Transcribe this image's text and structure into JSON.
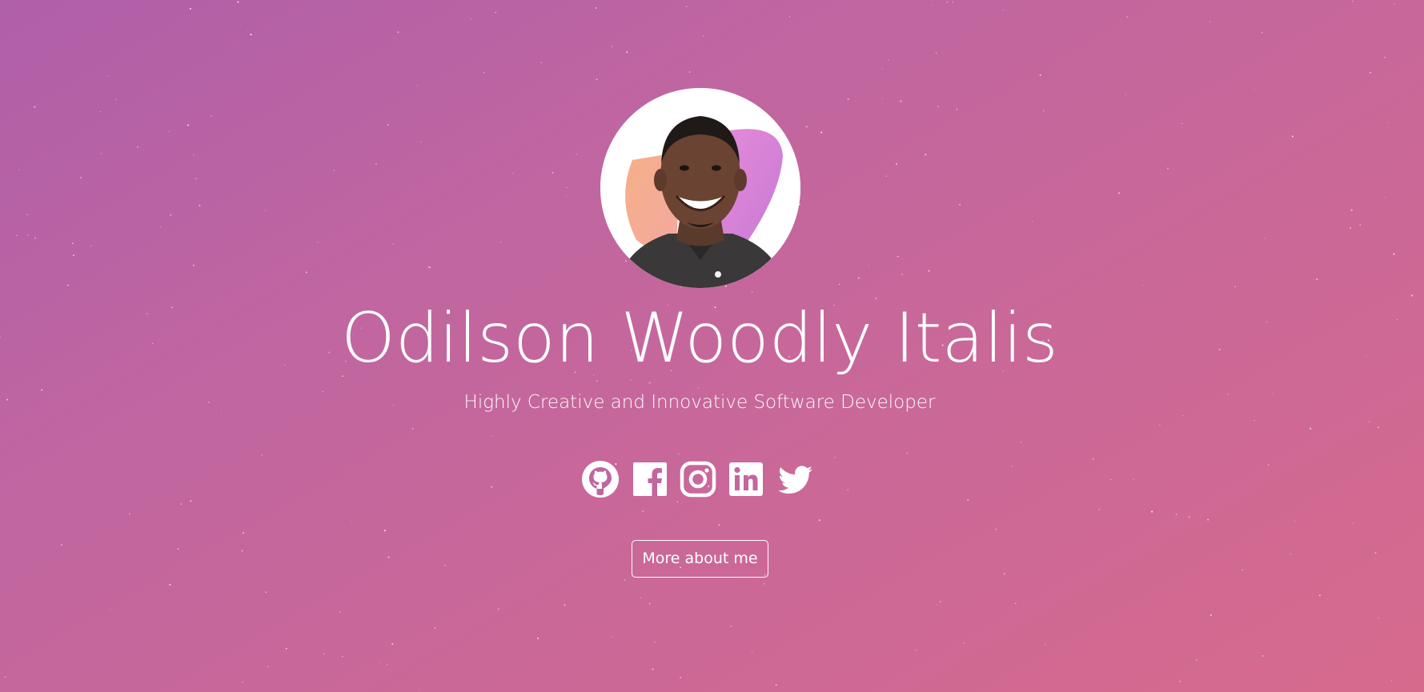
{
  "hero": {
    "name": "Odilson Woodly Italis",
    "tagline": "Highly Creative and Innovative Software Developer",
    "avatar_alt": "Portrait of Odilson Woodly Italis"
  },
  "socials": [
    {
      "icon": "github-icon",
      "label": "GitHub"
    },
    {
      "icon": "facebook-icon",
      "label": "Facebook"
    },
    {
      "icon": "instagram-icon",
      "label": "Instagram"
    },
    {
      "icon": "linkedin-icon",
      "label": "LinkedIn"
    },
    {
      "icon": "twitter-icon",
      "label": "Twitter"
    }
  ],
  "cta": {
    "label": "More about me"
  },
  "colors": {
    "gradient_start": "#b05fa9",
    "gradient_end": "#d66a8d",
    "text": "#ffffff"
  }
}
